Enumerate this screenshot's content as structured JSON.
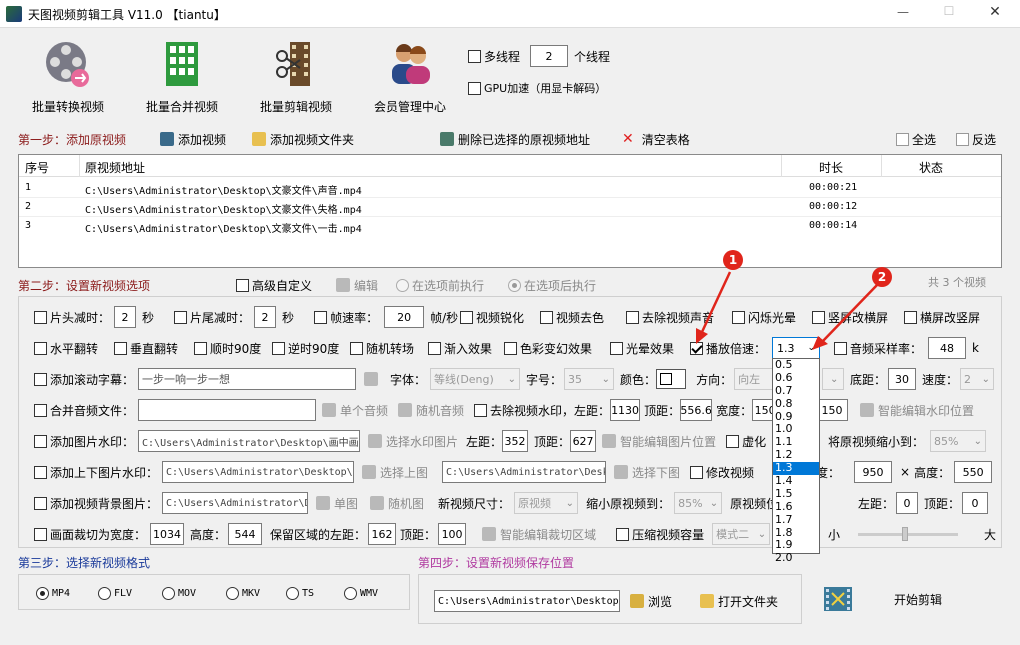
{
  "window": {
    "title": "天图视频剪辑工具 V11.0 【tiantu】",
    "minimize": "—",
    "maximize": "☐",
    "close": "✕"
  },
  "toolbar": {
    "batch_convert": "批量转换视频",
    "batch_merge": "批量合并视频",
    "batch_cut": "批量剪辑视频",
    "member": "会员管理中心",
    "multithread": "多线程",
    "threads": "2",
    "threads_unit": "个线程",
    "gpu": "GPU加速（用显卡解码）"
  },
  "step1": {
    "title": "第一步：添加原视频",
    "add_video": "添加视频",
    "add_folder": "添加视频文件夹",
    "delete_selected": "删除已选择的原视频地址",
    "clear_table": "清空表格",
    "select_all": "全选",
    "invert": "反选"
  },
  "table": {
    "columns": [
      "序号",
      "原视频地址",
      "时长",
      "状态"
    ],
    "rows": [
      {
        "no": "1",
        "path": "C:\\Users\\Administrator\\Desktop\\文豪文件\\声音.mp4",
        "duration": "00:00:21",
        "status": ""
      },
      {
        "no": "2",
        "path": "C:\\Users\\Administrator\\Desktop\\文豪文件\\失格.mp4",
        "duration": "00:00:12",
        "status": ""
      },
      {
        "no": "3",
        "path": "C:\\Users\\Administrator\\Desktop\\文豪文件\\一击.mp4",
        "duration": "00:00:14",
        "status": ""
      }
    ],
    "count_text": "共 3 个视频"
  },
  "step2": {
    "title": "第二步：设置新视频选项",
    "advanced": "高级自定义",
    "edit": "编辑",
    "before": "在选项前执行",
    "after": "在选项后执行",
    "r1": {
      "head_cut": "片头减时：",
      "head_val": "2",
      "sec1": "秒",
      "tail_cut": "片尾减时：",
      "tail_val": "2",
      "sec2": "秒",
      "framerate": "帧速率：",
      "fr_val": "20",
      "fr_unit": "帧/秒",
      "sharpen": "视频锐化",
      "desat": "视频去色",
      "remove_audio": "去除视频声音",
      "flash": "闪烁光晕",
      "v2h": "竖屏改横屏",
      "h2v": "横屏改竖屏"
    },
    "r2": {
      "hflip": "水平翻转",
      "vflip": "垂直翻转",
      "rot90": "顺时90度",
      "rot90cc": "逆时90度",
      "random": "随机转场",
      "fadein": "渐入效果",
      "color": "色彩变幻效果",
      "light": "光晕效果",
      "speed": "播放倍速：",
      "speed_val": "1.3",
      "samplerate": "音频采样率：",
      "sr_val": "48",
      "sr_unit": "k"
    },
    "r3": {
      "subtitle": "添加滚动字幕：",
      "subtitle_text": "一步一响一步一想",
      "font_label": "字体：",
      "font_val": "等线(Deng)",
      "size_label": "字号：",
      "size_val": "35",
      "color_label": "颜色：",
      "dir_label": "方向：",
      "dir_val": "向左",
      "bottom_label": "底距：",
      "bottom_val": "30",
      "speed_label": "速度：",
      "speed_val": "2"
    },
    "r4": {
      "merge_audio": "合并音频文件：",
      "single_audio": "单个音频",
      "random_audio": "随机音频",
      "remove_wm": "去除视频水印，左距：",
      "left_val": "1130",
      "top_label": "顶距：",
      "top_val": "556.6",
      "width_label": "宽度：",
      "width_val": "150",
      "height_val": "150",
      "smart_wm": "智能编辑水印位置"
    },
    "r5": {
      "img_wm": "添加图片水印：",
      "img_path": "C:\\Users\\Administrator\\Desktop\\画中画",
      "choose_img": "选择水印图片",
      "left_label": "左距：",
      "left_val": "352",
      "top_label": "顶距：",
      "top_val": "627",
      "smart_img": "智能编辑图片位置",
      "blur": "虚化",
      "shrink": "，将原视频缩小到：",
      "shrink_val": "85%"
    },
    "r6": {
      "tb_img": "添加上下图片水印：",
      "tb_path1": "C:\\Users\\Administrator\\Desktop\\Q",
      "choose_top": "选择上图",
      "tb_path2": "C:\\Users\\Administrator\\Desk",
      "choose_bottom": "选择下图",
      "modify_size": "修改视频",
      "degree_suffix": "度：",
      "w_val": "950",
      "x": "×",
      "height_label": "高度：",
      "h_val": "550"
    },
    "r7": {
      "bg_img": "添加视频背景图片：",
      "bg_path": "C:\\Users\\Administrator\\D",
      "single": "单图",
      "random": "随机图",
      "new_size": "新视频尺寸：",
      "new_size_val": "原视频",
      "shrink_to": "缩小原视频到：",
      "shrink_val": "85%",
      "pos": "原视频位",
      "left_label": "左距：",
      "left_val": "0",
      "top_label": "顶距：",
      "top_val": "0"
    },
    "r8": {
      "crop": "画面裁切为宽度：",
      "w_val": "1034",
      "h_label": "高度：",
      "h_val": "544",
      "keep_left": "保留区域的左距：",
      "left_val": "162",
      "top_label": "顶距：",
      "top_val": "100",
      "smart_crop": "智能编辑裁切区域",
      "compress": "压缩视频容量",
      "mode_val": "模式二",
      "small": "小",
      "large": "大"
    }
  },
  "dropdown": {
    "options": [
      "0.5",
      "0.6",
      "0.7",
      "0.8",
      "0.9",
      "1.0",
      "1.1",
      "1.2",
      "1.3",
      "1.4",
      "1.5",
      "1.6",
      "1.7",
      "1.8",
      "1.9",
      "2.0"
    ],
    "selected": "1.3"
  },
  "step3": {
    "title": "第三步：选择新视频格式",
    "formats": [
      "MP4",
      "FLV",
      "MOV",
      "MKV",
      "TS",
      "WMV"
    ]
  },
  "step4": {
    "title": "第四步：设置新视频保存位置",
    "path": "C:\\Users\\Administrator\\Desktop\\",
    "browse": "浏览",
    "open_folder": "打开文件夹",
    "start": "开始剪辑"
  },
  "annotations": {
    "a1": "1",
    "a2": "2"
  },
  "colors": {
    "red_annotation": "#e0251b",
    "highlight": "#0078d7"
  }
}
